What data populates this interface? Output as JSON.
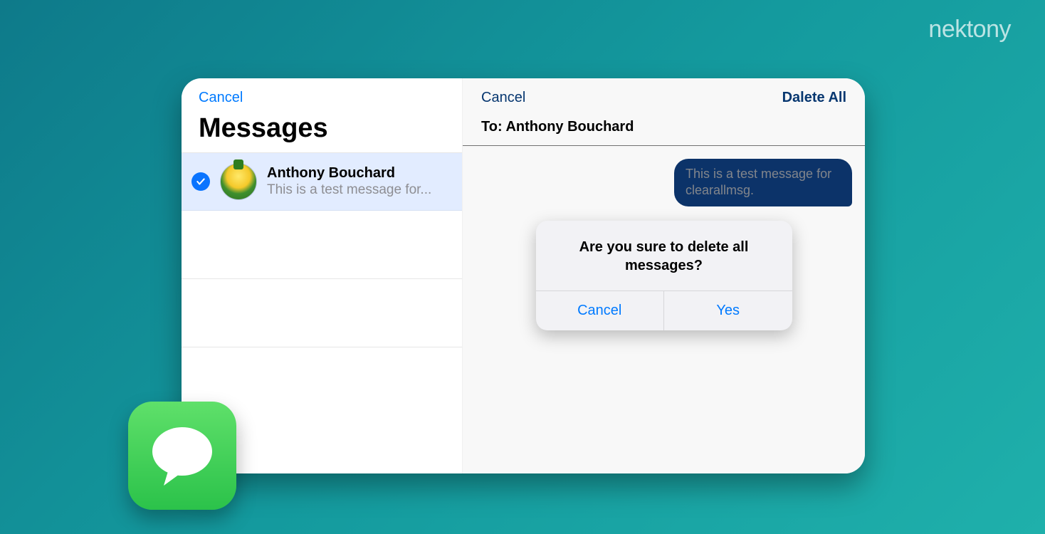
{
  "brand": "nektony",
  "sidebar": {
    "cancel_label": "Cancel",
    "title": "Messages",
    "conversation": {
      "name": "Anthony Bouchard",
      "preview": "This is a test message for..."
    }
  },
  "pane": {
    "cancel_label": "Cancel",
    "delete_all_label": "Dalete All",
    "to_prefix": "To: ",
    "to_name": "Anthony Bouchard",
    "bubble_text": "This is a test message for clearallmsg."
  },
  "alert": {
    "title": "Are you sure to delete all messages?",
    "cancel_label": "Cancel",
    "yes_label": "Yes"
  }
}
